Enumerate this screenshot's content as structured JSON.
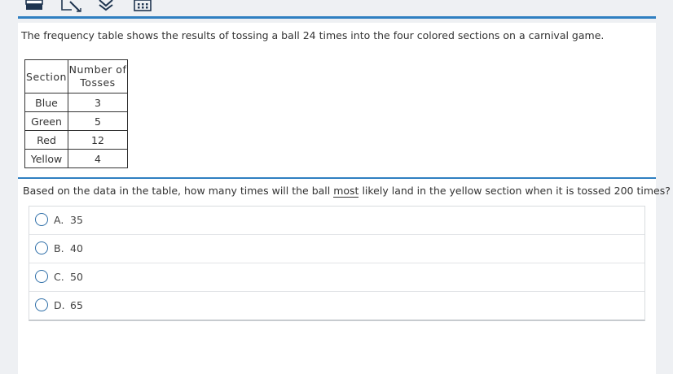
{
  "toolbar": {
    "tools": [
      {
        "icon": "calculator-icon"
      },
      {
        "icon": "ruler-pencil-icon"
      },
      {
        "icon": "bookmark-flag-icon"
      },
      {
        "icon": "grid-reference-icon"
      }
    ],
    "accent": "#2f7fc1"
  },
  "intro": "The frequency table shows the results of tossing a ball 24 times into the four colored sections on a carnival game.",
  "table": {
    "headers": [
      "Section",
      "Number of Tosses"
    ],
    "rows": [
      {
        "section": "Blue",
        "tosses": "3"
      },
      {
        "section": "Green",
        "tosses": "5"
      },
      {
        "section": "Red",
        "tosses": "12"
      },
      {
        "section": "Yellow",
        "tosses": "4"
      }
    ]
  },
  "question": {
    "before": "Based on the data in the table, how many times will the ball ",
    "emphasis": "most",
    "after": " likely land in the yellow section when it is tossed 200 times?"
  },
  "choices": [
    {
      "letter": "A.",
      "value": "35"
    },
    {
      "letter": "B.",
      "value": "40"
    },
    {
      "letter": "C.",
      "value": "50"
    },
    {
      "letter": "D.",
      "value": "65"
    }
  ]
}
